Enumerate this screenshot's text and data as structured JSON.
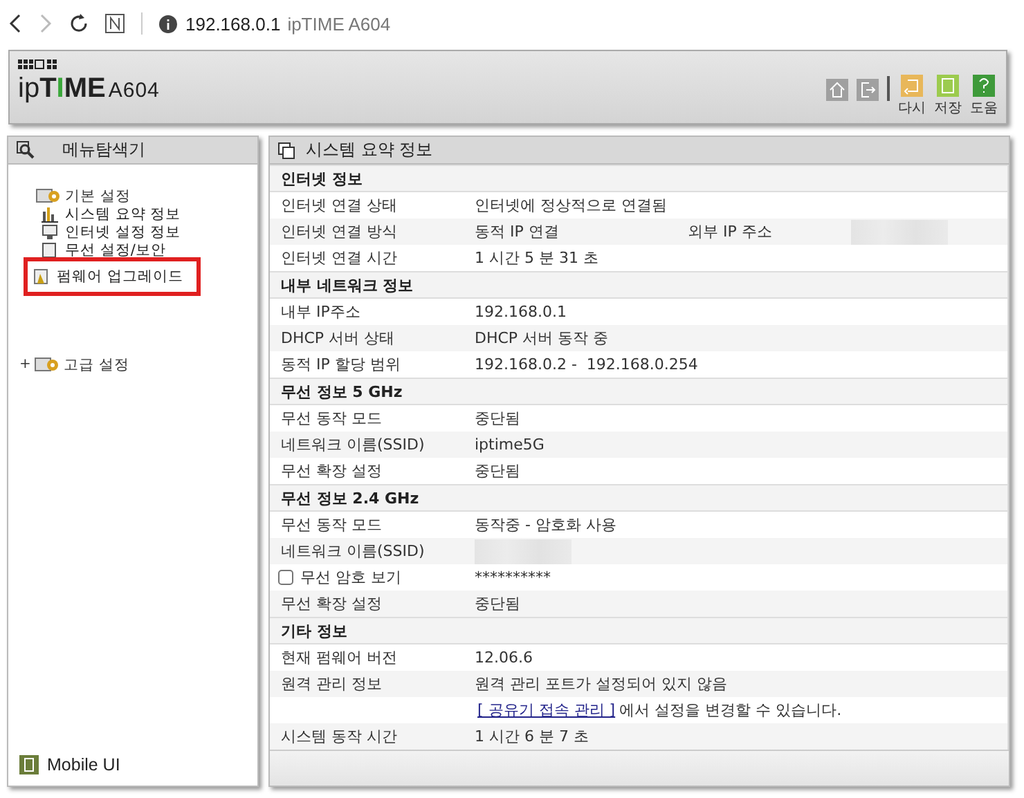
{
  "browser": {
    "url_host": "192.168.0.1",
    "url_title": "ipTIME A604"
  },
  "header": {
    "logo": {
      "lead": "ip",
      "bold_a": "T",
      "green": "I",
      "bold_b": "ME",
      "model": "A604"
    },
    "tools": [
      {
        "kind": "home"
      },
      {
        "kind": "logout"
      },
      {
        "kind": "separator"
      },
      {
        "kind": "undo",
        "label": "다시",
        "color": "#e8b75a"
      },
      {
        "kind": "save",
        "label": "저장",
        "color": "#9ccb4e"
      },
      {
        "kind": "help",
        "label": "도움",
        "color": "#3e9a3a"
      }
    ]
  },
  "sidebar": {
    "title": "메뉴탐색기",
    "tree": [
      {
        "label": "기본 설정",
        "kind": "folder",
        "expanded": true,
        "children": [
          {
            "label": "시스템 요약 정보",
            "kind": "chart",
            "highlighted": false
          },
          {
            "label": "인터넷 설정 정보",
            "kind": "monitor",
            "highlighted": false
          },
          {
            "label": "무선 설정/보안",
            "kind": "page",
            "highlighted": false
          },
          {
            "label": "펌웨어 업그레이드",
            "kind": "firmware",
            "highlighted": true
          }
        ]
      },
      {
        "label": "고급 설정",
        "kind": "folder",
        "expanded": false,
        "toggle": "+"
      }
    ],
    "mobile": "Mobile UI"
  },
  "panel": {
    "title": "시스템 요약 정보",
    "rows": [
      {
        "kind": "section",
        "label": "인터넷 정보"
      },
      {
        "kind": "row",
        "label": "인터넷 연결 상태",
        "value": "인터넷에 정상적으로 연결됨"
      },
      {
        "kind": "row",
        "label": "인터넷 연결 방식",
        "value": "동적 IP 연결",
        "extra_label": "외부 IP 주소",
        "masked": true
      },
      {
        "kind": "row",
        "label": "인터넷 연결 시간",
        "value": "1 시간 5 분 31 초"
      },
      {
        "kind": "section",
        "label": "내부 네트워크 정보"
      },
      {
        "kind": "row",
        "label": "내부 IP주소",
        "value": "192.168.0.1"
      },
      {
        "kind": "row",
        "label": "DHCP 서버 상태",
        "value": "DHCP 서버 동작 중"
      },
      {
        "kind": "row",
        "label": "동적 IP 할당 범위",
        "value": "192.168.0.2 -  192.168.0.254"
      },
      {
        "kind": "section",
        "label": "무선 정보 5 GHz"
      },
      {
        "kind": "row",
        "label": "무선 동작 모드",
        "value": "중단됨"
      },
      {
        "kind": "row",
        "label": "네트워크 이름(SSID)",
        "value": "iptime5G"
      },
      {
        "kind": "row",
        "label": "무선 확장 설정",
        "value": "중단됨"
      },
      {
        "kind": "section",
        "label": "무선 정보 2.4 GHz"
      },
      {
        "kind": "row",
        "label": "무선 동작 모드",
        "value": "동작중 - 암호화 사용"
      },
      {
        "kind": "row",
        "label": "네트워크 이름(SSID)",
        "masked": true
      },
      {
        "kind": "checkbox",
        "label": "무선 암호 보기",
        "checked": false,
        "value": "**********"
      },
      {
        "kind": "row",
        "label": "무선 확장 설정",
        "value": "중단됨"
      },
      {
        "kind": "section",
        "label": "기타 정보"
      },
      {
        "kind": "row",
        "label": "현재 펌웨어 버전",
        "value": "12.06.6"
      },
      {
        "kind": "row",
        "label": "원격 관리 정보",
        "value": "원격 관리 포트가 설정되어 있지 않음"
      },
      {
        "kind": "link",
        "link": "[ 공유기 접속 관리 ]",
        "value": "에서 설정을 변경할 수 있습니다."
      },
      {
        "kind": "row",
        "label": "시스템 동작 시간",
        "value": "1 시간 6 분 7 초"
      }
    ]
  }
}
